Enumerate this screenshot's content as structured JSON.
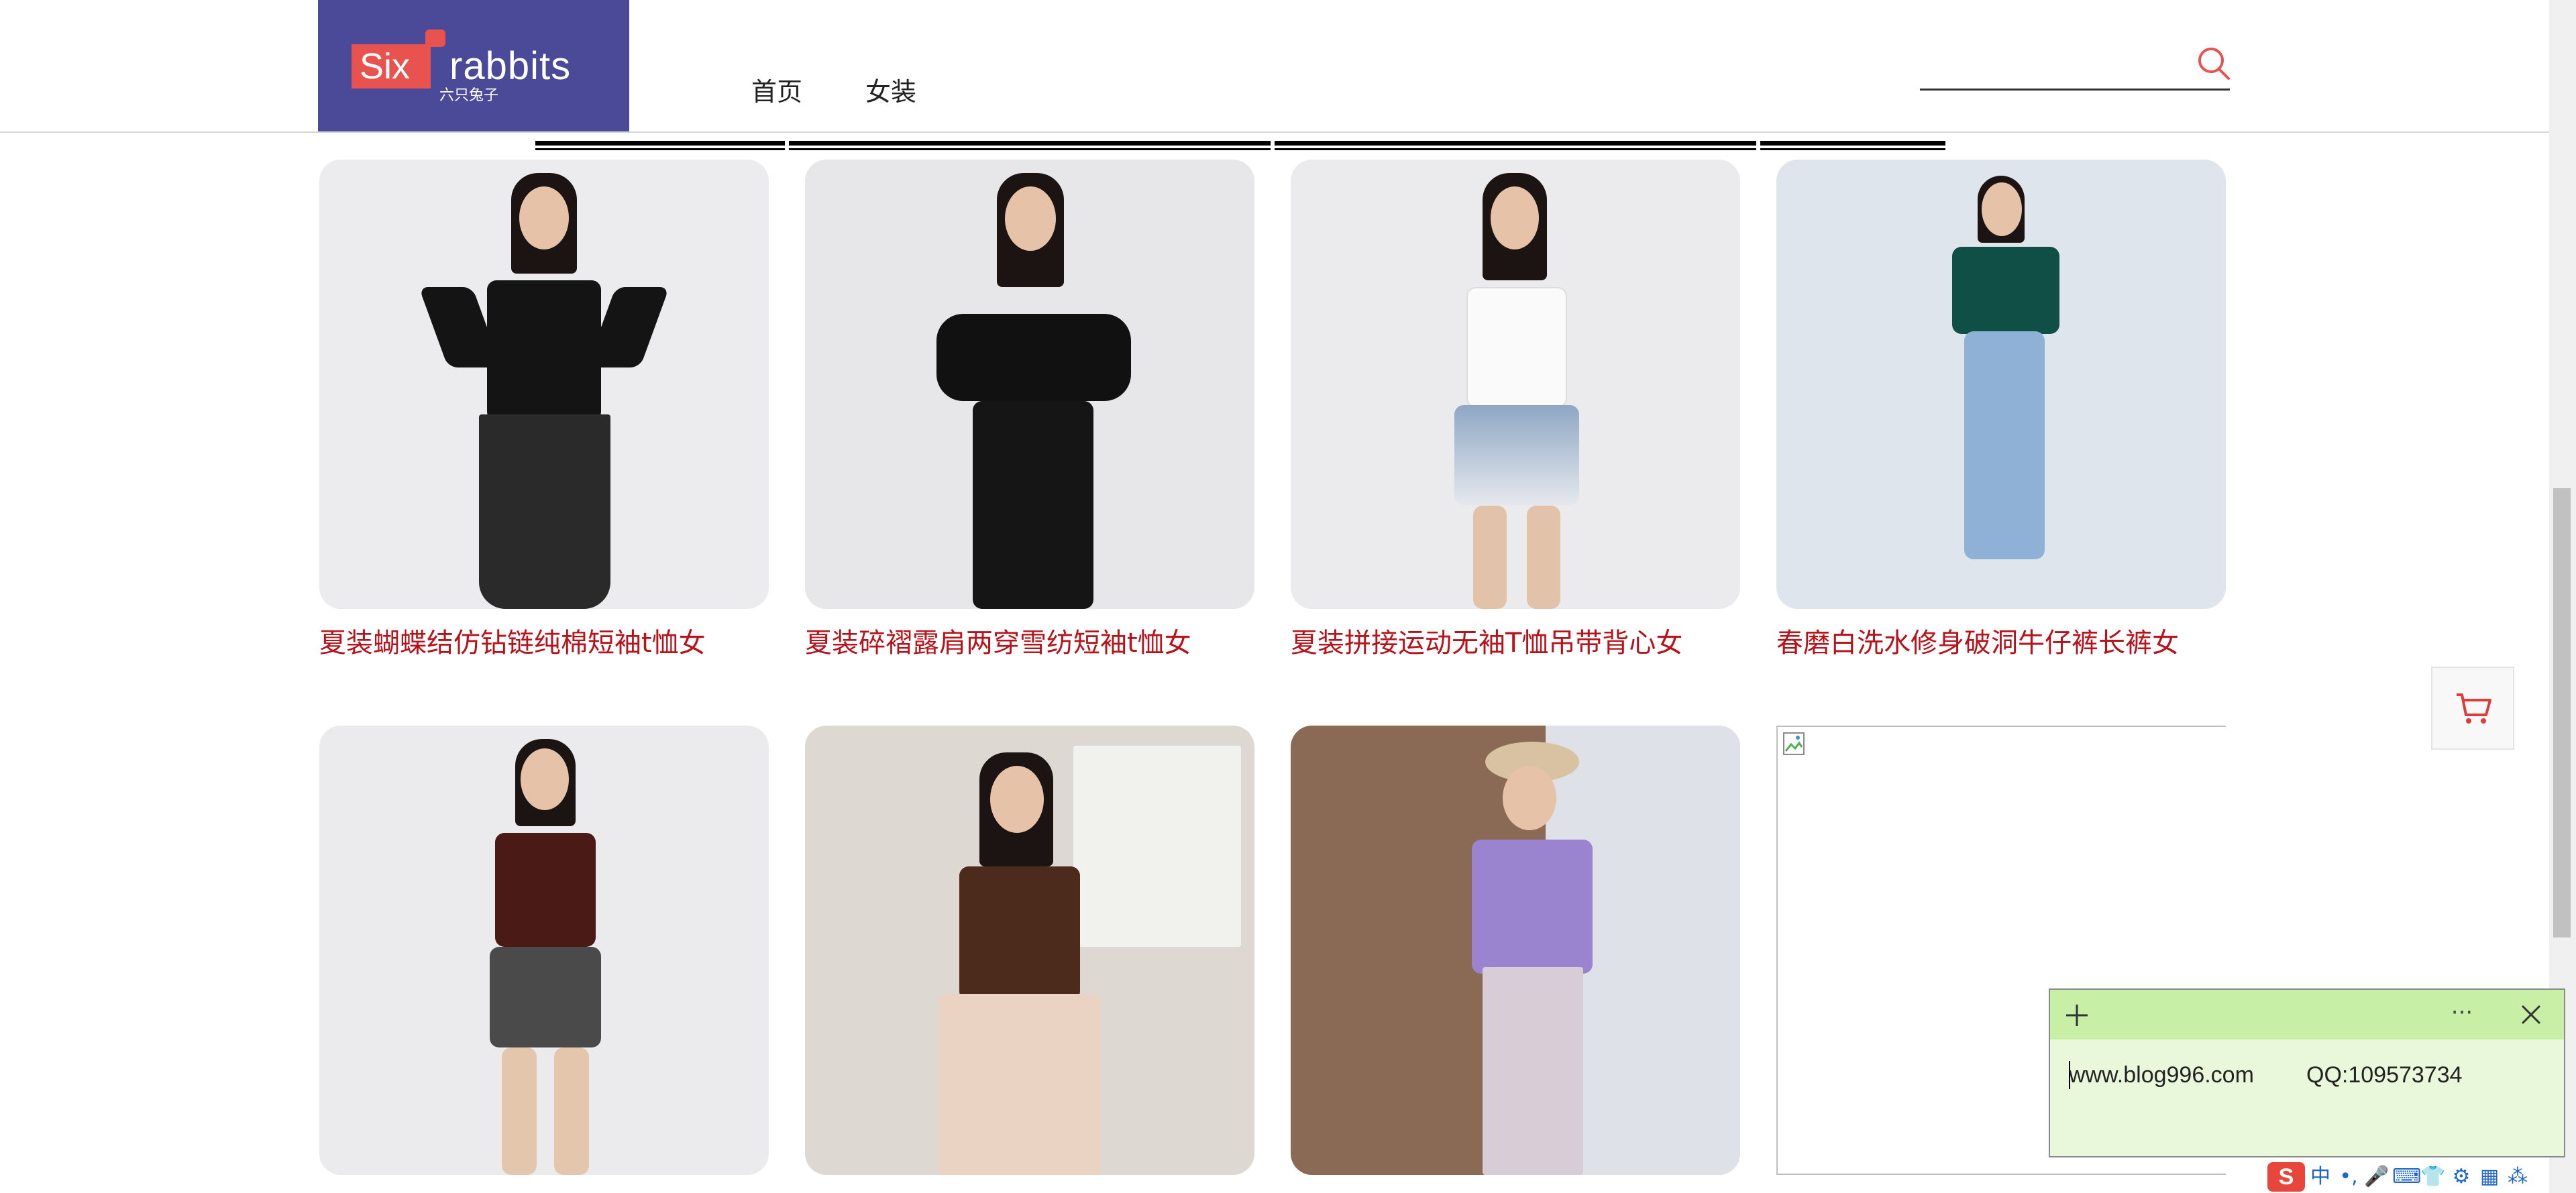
{
  "header": {
    "logo": {
      "brand_main": "Six",
      "brand_second": "rabbits",
      "brand_sub": "六只兔子",
      "colors": {
        "background": "#4a4a98",
        "badge": "#e8524f"
      }
    },
    "nav": [
      {
        "label": "首页"
      },
      {
        "label": "女装"
      }
    ],
    "search": {
      "icon": "search-icon",
      "accent": "#e8524f"
    }
  },
  "products": [
    {
      "title": "夏装蝴蝶结仿钻链纯棉短袖t恤女",
      "image": "model-black-tshirt-pleated-skirt"
    },
    {
      "title": "夏装碎褶露肩两穿雪纺短袖t恤女",
      "image": "model-offshoulder-black-top-floral-skirt"
    },
    {
      "title": "夏装拼接运动无袖T恤吊带背心女",
      "image": "model-white-tank-denim-shorts"
    },
    {
      "title": "春磨白洗水修身破洞牛仔裤长裤女",
      "image": "model-green-blouse-jeans"
    },
    {
      "title": "",
      "image": "model-polka-dot-polo-grey-shorts"
    },
    {
      "title": "",
      "image": "model-brown-vest-beige-dress"
    },
    {
      "title": "",
      "image": "model-purple-shirt-floral-dress"
    },
    {
      "title": "",
      "image": "broken-image"
    }
  ],
  "title_color": "#b8121a",
  "cart": {
    "icon": "cart-icon",
    "color": "#e03a3a"
  },
  "sticky_note": {
    "site": "www.blog996.com",
    "qq": "QQ:109573734",
    "more": "···",
    "colors": {
      "header": "#c7f0a6",
      "body": "#e9f8da"
    }
  },
  "ime_toolbar": {
    "logo": "S",
    "items": [
      "中",
      "•,",
      "🎤",
      "⌨",
      "👕",
      "⚙",
      "▦",
      "⁂"
    ]
  }
}
